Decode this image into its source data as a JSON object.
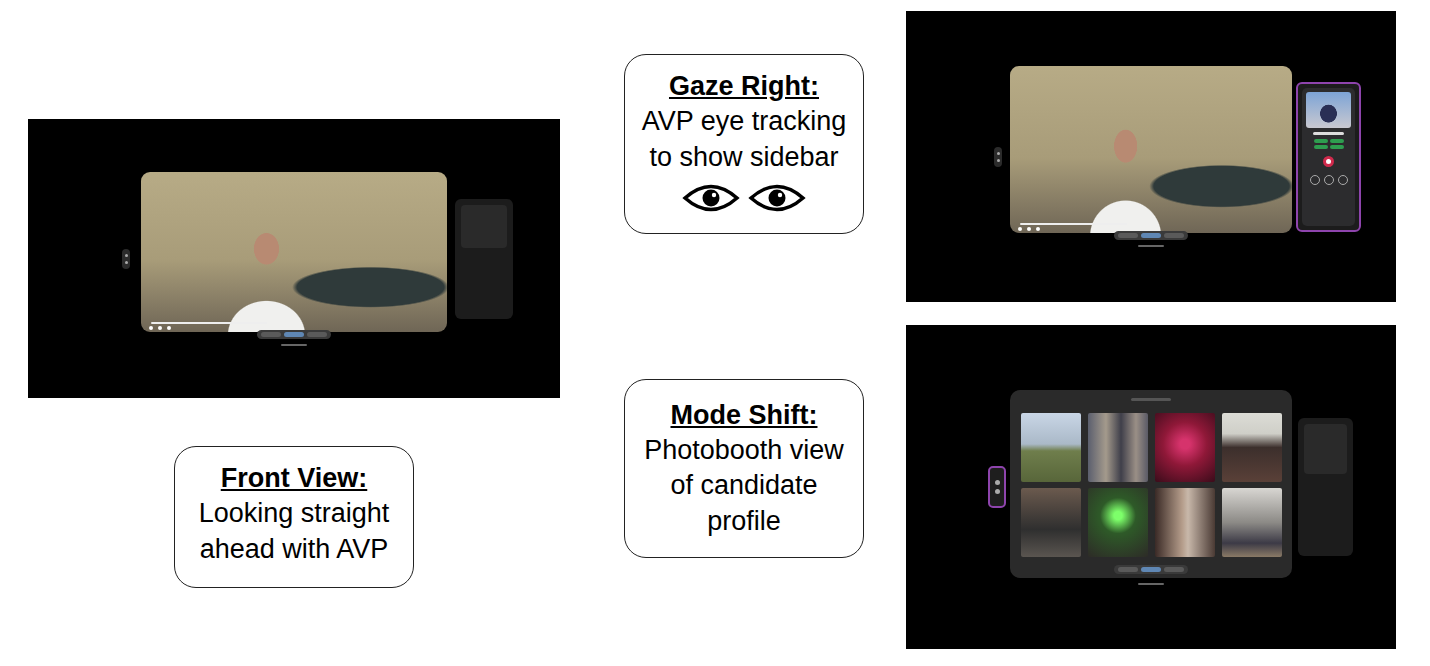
{
  "figure": {
    "panels": [
      {
        "kind": "video",
        "sidebar_highlighted": false,
        "toolbar_highlighted": false
      },
      {
        "kind": "video",
        "sidebar_highlighted": true,
        "toolbar_highlighted": false
      },
      {
        "kind": "photobooth",
        "sidebar_highlighted": false,
        "toolbar_highlighted": true
      }
    ],
    "captions": [
      {
        "kind": "plain",
        "title": "Front View:",
        "lines": [
          "Looking straight",
          "ahead with AVP"
        ]
      },
      {
        "kind": "eyes",
        "title": "Gaze Right:",
        "lines": [
          "AVP eye tracking",
          "to show sidebar"
        ]
      },
      {
        "kind": "plain",
        "title": "Mode Shift:",
        "lines": [
          "Photobooth view",
          "of candidate",
          "profile"
        ]
      }
    ]
  }
}
